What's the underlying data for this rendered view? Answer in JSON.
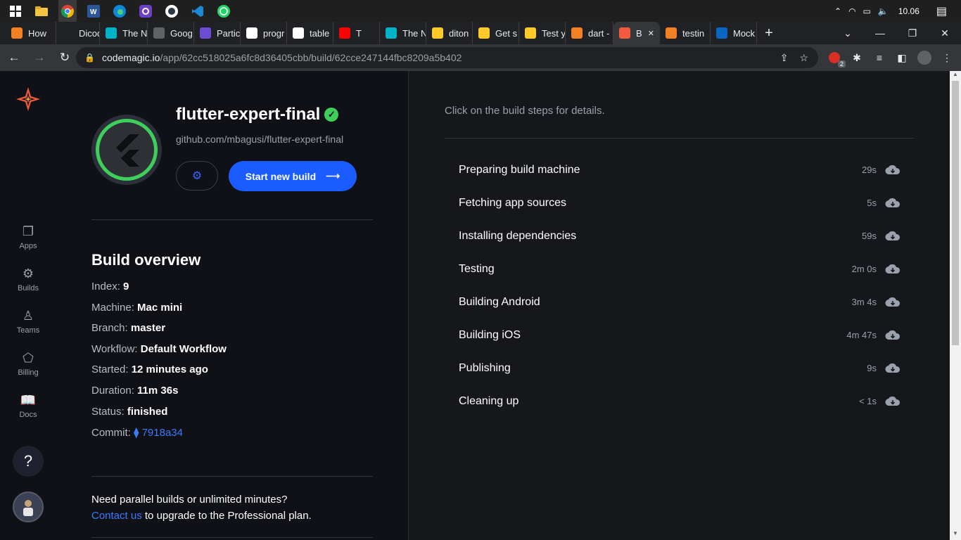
{
  "taskbar": {
    "time": "10.06",
    "icons": [
      "windows-start",
      "file-explorer",
      "chrome",
      "word",
      "edge",
      "github-desktop",
      "app-circle",
      "vscode",
      "whatsapp"
    ]
  },
  "tabs": [
    {
      "label": "How",
      "icon": "stackoverflow",
      "color": "#f48024"
    },
    {
      "label": "Dicod",
      "icon": "g",
      "color": "#202124"
    },
    {
      "label": "The N",
      "icon": "codemagic-bar",
      "color": "#00b3c7"
    },
    {
      "label": "Goog",
      "icon": "globe",
      "color": "#5f6368"
    },
    {
      "label": "Partic",
      "icon": "list",
      "color": "#6c4cd3"
    },
    {
      "label": "progr",
      "icon": "google",
      "color": "#ffffff"
    },
    {
      "label": "table",
      "icon": "google",
      "color": "#ffffff"
    },
    {
      "label": "T",
      "icon": "youtube",
      "color": "#ff0000"
    },
    {
      "label": "The N",
      "icon": "codemagic-bar",
      "color": "#00b3c7"
    },
    {
      "label": "diton",
      "icon": "firebase",
      "color": "#ffca28"
    },
    {
      "label": "Get s",
      "icon": "firebase",
      "color": "#ffca28"
    },
    {
      "label": "Test y",
      "icon": "firebase",
      "color": "#ffca28"
    },
    {
      "label": "dart -",
      "icon": "stackoverflow",
      "color": "#f48024"
    },
    {
      "label": "B",
      "icon": "codemagic",
      "color": "#f45a3d",
      "active": true
    },
    {
      "label": "testin",
      "icon": "stackoverflow",
      "color": "#f48024"
    },
    {
      "label": "Mock",
      "icon": "linkedin",
      "color": "#0a66c2"
    }
  ],
  "address": {
    "host": "codemagic.io",
    "path": "/app/62cc518025a6fc8d36405cbb/build/62cce247144fbc8209a5b402",
    "ext_badge": "2"
  },
  "sidebar": {
    "items": [
      {
        "label": "Apps",
        "icon": "apps-icon"
      },
      {
        "label": "Builds",
        "icon": "builds-icon"
      },
      {
        "label": "Teams",
        "icon": "teams-icon"
      },
      {
        "label": "Billing",
        "icon": "billing-icon"
      },
      {
        "label": "Docs",
        "icon": "docs-icon"
      }
    ],
    "help": "?"
  },
  "app": {
    "title": "flutter-expert-final",
    "repo": "github.com/mbagusi/flutter-expert-final",
    "start_button": "Start new build"
  },
  "overview": {
    "title": "Build overview",
    "rows": [
      {
        "label": "Index: ",
        "value": "9"
      },
      {
        "label": "Machine: ",
        "value": "Mac mini"
      },
      {
        "label": "Branch: ",
        "value": "master"
      },
      {
        "label": "Workflow: ",
        "value": "Default Workflow"
      },
      {
        "label": "Started: ",
        "value": "12 minutes ago"
      },
      {
        "label": "Duration: ",
        "value": "11m 36s"
      },
      {
        "label": "Status: ",
        "value": "finished"
      }
    ],
    "commit_label": "Commit: ",
    "commit_value": "7918a34"
  },
  "upgrade": {
    "line1": "Need parallel builds or unlimited minutes?",
    "link": "Contact us",
    "line2": " to upgrade to the Professional plan."
  },
  "steps_hint": "Click on the build steps for details.",
  "steps": [
    {
      "name": "Preparing build machine",
      "duration": "29s"
    },
    {
      "name": "Fetching app sources",
      "duration": "5s"
    },
    {
      "name": "Installing dependencies",
      "duration": "59s"
    },
    {
      "name": "Testing",
      "duration": "2m 0s"
    },
    {
      "name": "Building Android",
      "duration": "3m 4s"
    },
    {
      "name": "Building iOS",
      "duration": "4m 47s"
    },
    {
      "name": "Publishing",
      "duration": "9s"
    },
    {
      "name": "Cleaning up",
      "duration": "< 1s"
    }
  ]
}
